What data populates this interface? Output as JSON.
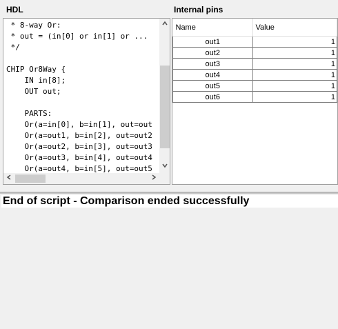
{
  "hdl": {
    "title": "HDL",
    "lines": [
      " * 8-way Or:",
      " * out = (in[0] or in[1] or ...",
      " */",
      "",
      "CHIP Or8Way {",
      "    IN in[8];",
      "    OUT out;",
      "",
      "    PARTS:",
      "    Or(a=in[0], b=in[1], out=out",
      "    Or(a=out1, b=in[2], out=out2",
      "    Or(a=out2, b=in[3], out=out3",
      "    Or(a=out3, b=in[4], out=out4",
      "    Or(a=out4, b=in[5], out=out5"
    ]
  },
  "pins": {
    "title": "Internal pins",
    "columns": [
      "Name",
      "Value"
    ],
    "rows": [
      {
        "name": "out1",
        "value": "1"
      },
      {
        "name": "out2",
        "value": "1"
      },
      {
        "name": "out3",
        "value": "1"
      },
      {
        "name": "out4",
        "value": "1"
      },
      {
        "name": "out5",
        "value": "1"
      },
      {
        "name": "out6",
        "value": "1"
      }
    ]
  },
  "status": {
    "message": "End of script - Comparison ended successfully"
  },
  "icons": {
    "scroll_up": "▲",
    "scroll_down": "▼",
    "scroll_left": "◀",
    "scroll_right": "▶"
  }
}
